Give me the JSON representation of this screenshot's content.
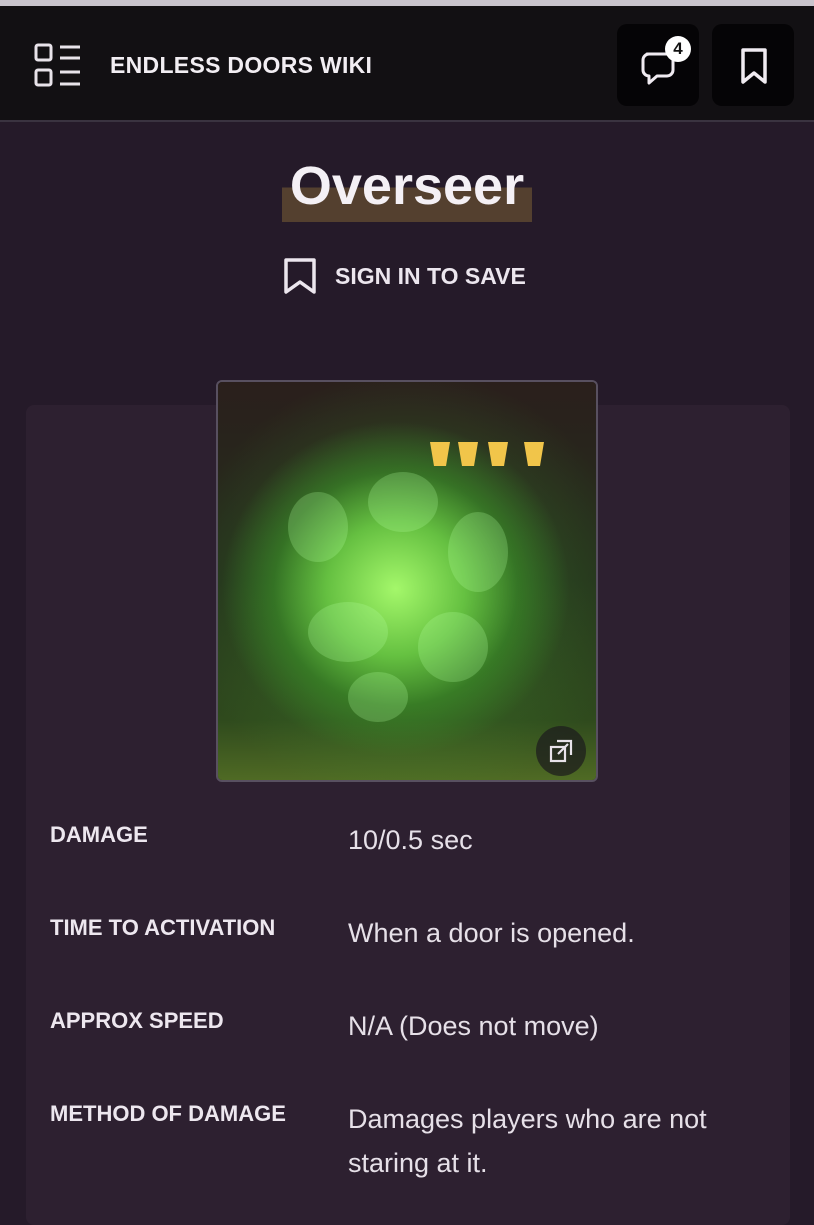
{
  "header": {
    "site_title": "ENDLESS DOORS WIKI",
    "comments_count": "4"
  },
  "page": {
    "title": "Overseer",
    "save_label": "SIGN IN TO SAVE"
  },
  "infobox": {
    "rows": [
      {
        "label": "DAMAGE",
        "value": "10/0.5 sec"
      },
      {
        "label": "TIME TO ACTIVATION",
        "value": "When a door is opened."
      },
      {
        "label": "APPROX SPEED",
        "value": "N/A (Does not move)"
      },
      {
        "label": "METHOD OF DAMAGE",
        "value": "Damages players who are not staring at it."
      }
    ]
  },
  "icons": [
    "menu-icon",
    "comments-icon",
    "bookmark-icon",
    "expand-icon"
  ],
  "colors": {
    "background": "#251a29",
    "header": "#121013",
    "title_highlight": "#54402f",
    "infobox": "#2d2030"
  }
}
